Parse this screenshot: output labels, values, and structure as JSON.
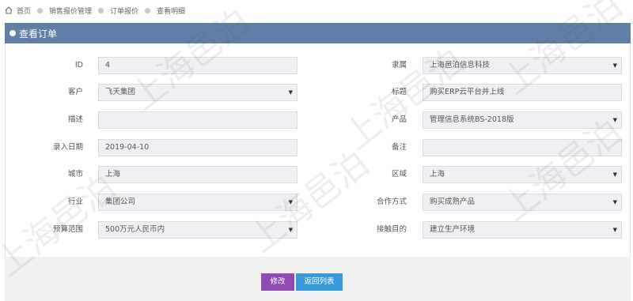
{
  "breadcrumb": {
    "items": [
      "首页",
      "销售报价管理",
      "订单报价",
      "查看明细"
    ]
  },
  "header": {
    "title": "查看订单"
  },
  "form": {
    "id": {
      "label": "ID",
      "value": "4"
    },
    "owner": {
      "label": "隶属",
      "value": "上海邑泊信息科技"
    },
    "customer": {
      "label": "客户",
      "value": "飞天集团"
    },
    "subject": {
      "label": "标题",
      "value": "购买ERP云平台并上线"
    },
    "description": {
      "label": "描述",
      "value": ""
    },
    "product": {
      "label": "产品",
      "value": "管理信息系统BS-2018版"
    },
    "entry_date": {
      "label": "录入日期",
      "value": "2019-04-10"
    },
    "remark": {
      "label": "备注",
      "value": ""
    },
    "city": {
      "label": "城市",
      "value": "上海"
    },
    "region": {
      "label": "区域",
      "value": "上海"
    },
    "industry": {
      "label": "行业",
      "value": "集团公司"
    },
    "cooperation": {
      "label": "合作方式",
      "value": "购买成熟产品"
    },
    "budget": {
      "label": "预算范围",
      "value": "500万元人民币内"
    },
    "purpose": {
      "label": "接触目的",
      "value": "建立生产环境"
    }
  },
  "buttons": {
    "edit": "修改",
    "back": "返回列表"
  },
  "watermark": "上海邑泊",
  "colors": {
    "title_bar": "#5f7fa6",
    "edit_button": "#8e4bb3",
    "back_button": "#3a9ad9"
  }
}
